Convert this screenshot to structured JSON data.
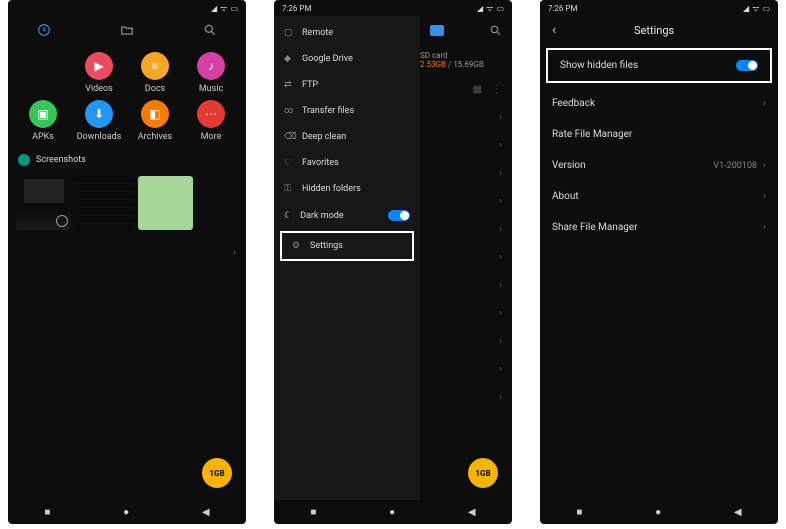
{
  "common": {
    "time": "7:26 PM",
    "fab_label": "1GB"
  },
  "screen1": {
    "tiles": [
      {
        "label": "Videos",
        "cls": "i-video"
      },
      {
        "label": "Docs",
        "cls": "i-docs"
      },
      {
        "label": "Music",
        "cls": "i-music"
      },
      {
        "label": "APKs",
        "cls": "i-apk"
      },
      {
        "label": "Downloads",
        "cls": "i-dl"
      },
      {
        "label": "Archives",
        "cls": "i-arc"
      },
      {
        "label": "More",
        "cls": "i-more"
      }
    ],
    "section": "Screenshots"
  },
  "screen2": {
    "menu": [
      {
        "label": "Remote",
        "ico": "▢"
      },
      {
        "label": "Google Drive",
        "ico": "◆"
      },
      {
        "label": "FTP",
        "ico": "⇄"
      },
      {
        "label": "Transfer files",
        "ico": "∞"
      },
      {
        "label": "Deep clean",
        "ico": "⌫"
      },
      {
        "label": "Favorites",
        "ico": "♡"
      },
      {
        "label": "Hidden folders",
        "ico": "⚿"
      }
    ],
    "dark_label": "Dark mode",
    "settings_label": "Settings",
    "settings_ico": "⚙",
    "sd_label": "SD card",
    "sd_used": "2.53GB",
    "sd_total": "15.69GB",
    "sd_sep": " / "
  },
  "screen3": {
    "title": "Settings",
    "rows": {
      "show_hidden": "Show hidden files",
      "feedback": "Feedback",
      "rate": "Rate File Manager",
      "version": "Version",
      "version_val": "V1-200108",
      "about": "About",
      "share": "Share File Manager"
    }
  }
}
